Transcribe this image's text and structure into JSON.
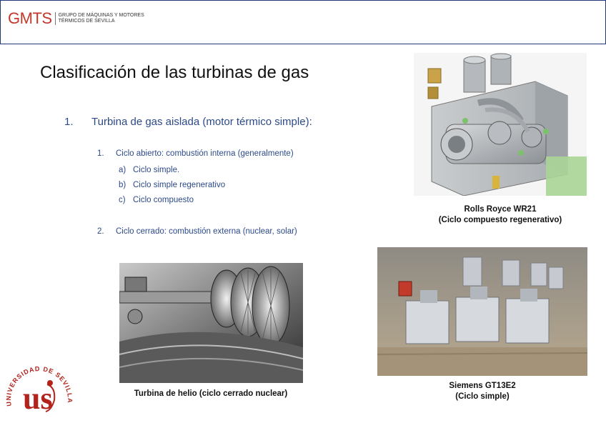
{
  "header": {
    "logo_mark": "GMTS",
    "logo_line1": "Grupo de Máquinas y Motores",
    "logo_line2": "Térmicos de Sevilla"
  },
  "slide": {
    "title": "Clasificación de las turbinas de gas",
    "item1": {
      "num": "1.",
      "text": "Turbina de gas aislada (motor térmico simple):"
    },
    "sub1": {
      "num": "1.",
      "text": "Ciclo abierto: combustión interna (generalmente)"
    },
    "sub1_items": [
      {
        "num": "a)",
        "text": "Ciclo simple."
      },
      {
        "num": "b)",
        "text": "Ciclo simple regenerativo"
      },
      {
        "num": "c)",
        "text": "Ciclo compuesto"
      }
    ],
    "sub2": {
      "num": "2.",
      "text": "Ciclo cerrado: combustión externa (nuclear, solar)"
    }
  },
  "captions": {
    "rolls_line1": "Rolls Royce WR21",
    "rolls_line2": "(Ciclo compuesto regenerativo)",
    "siemens_line1": "Siemens GT13E2",
    "siemens_line2": "(Ciclo simple)",
    "helio": "Turbina de helio (ciclo cerrado nuclear)"
  },
  "university_logo": {
    "ring_text": "UNIVERSIDAD DE SEVILLA",
    "monogram": "us",
    "color": "#b3231c"
  },
  "colors": {
    "accent": "#2c4a8a",
    "header_border": "#1f3c78",
    "brand_red": "#c0392b"
  }
}
